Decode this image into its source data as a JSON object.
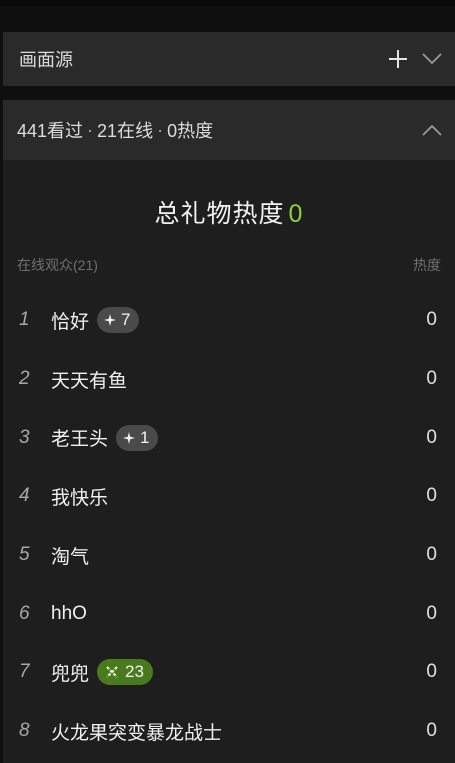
{
  "source_panel": {
    "title": "画面源",
    "add_icon": "plus-icon",
    "collapse_icon": "chevron-down-icon"
  },
  "stats_bar": {
    "viewed": "441看过",
    "sep1": "·",
    "online": "21在线",
    "sep2": "·",
    "heat": "0热度",
    "toggle_icon": "chevron-up-icon"
  },
  "gift": {
    "label": "总礼物热度",
    "value": "0",
    "value_color": "#8fce3c"
  },
  "columns": {
    "audience": "在线观众(21)",
    "heat": "热度"
  },
  "viewers": [
    {
      "rank": "1",
      "name": "恰好",
      "badge": {
        "icon": "sparkle-icon",
        "text": "7",
        "style": "gray"
      },
      "heat": "0"
    },
    {
      "rank": "2",
      "name": "天天有鱼",
      "badge": null,
      "heat": "0"
    },
    {
      "rank": "3",
      "name": "老王头",
      "badge": {
        "icon": "sparkle-icon",
        "text": "1",
        "style": "gray"
      },
      "heat": "0"
    },
    {
      "rank": "4",
      "name": "我快乐",
      "badge": null,
      "heat": "0"
    },
    {
      "rank": "5",
      "name": "淘气",
      "badge": null,
      "heat": "0"
    },
    {
      "rank": "6",
      "name": "hhO",
      "badge": null,
      "heat": "0"
    },
    {
      "rank": "7",
      "name": "兜兜",
      "badge": {
        "icon": "fan-level-icon",
        "text": "23",
        "style": "green"
      },
      "heat": "0"
    },
    {
      "rank": "8",
      "name": "火龙果突变暴龙战士",
      "badge": null,
      "heat": "0"
    }
  ]
}
